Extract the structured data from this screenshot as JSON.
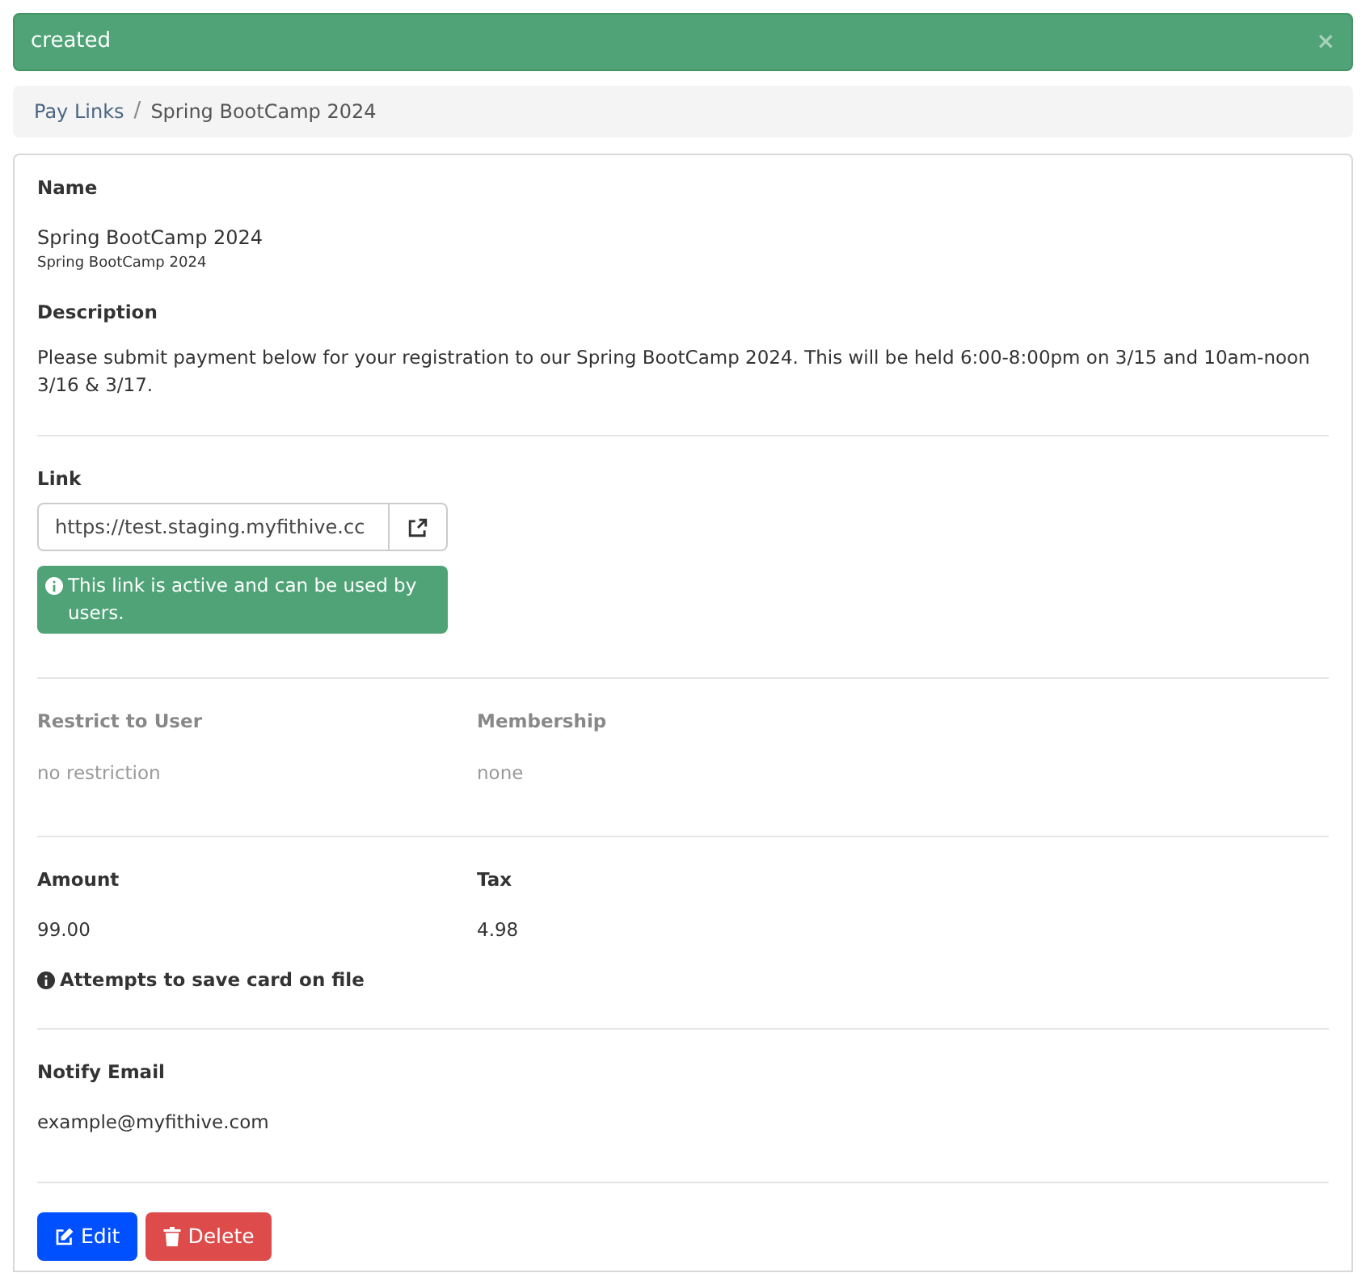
{
  "alert": {
    "text": "created",
    "close": "×"
  },
  "breadcrumb_separator": "/",
  "breadcrumb": [
    {
      "label": "Pay Links",
      "link": true
    },
    {
      "label": "Spring BootCamp 2024",
      "link": false
    }
  ],
  "name": {
    "label": "Name",
    "value": "Spring BootCamp 2024",
    "subtitle": "Spring BootCamp 2024"
  },
  "description": {
    "label": "Description",
    "value": "Please submit payment below for your registration to our Spring BootCamp 2024. This will be held 6:00-8:00pm on 3/15 and 10am-noon 3/16 & 3/17."
  },
  "link": {
    "label": "Link",
    "value": "https://test.staging.myfithive.cc",
    "active": true,
    "status": "This link is active and can be used by users."
  },
  "restrictions": {
    "disabled": true,
    "fields": [
      {
        "label": "Restrict to User",
        "value": "no restriction"
      },
      {
        "label": "Membership",
        "value": "none"
      }
    ]
  },
  "payment": {
    "disabled": false,
    "fields": [
      {
        "label": "Amount",
        "value": "99.00"
      },
      {
        "label": "Tax",
        "value": "4.98"
      }
    ],
    "note": "Attempts to save card on file"
  },
  "notify": {
    "label": "Notify Email",
    "value": "example@myfithive.com"
  },
  "buttons": [
    {
      "kind": "edit",
      "label": "Edit"
    },
    {
      "kind": "delete",
      "label": "Delete"
    }
  ]
}
